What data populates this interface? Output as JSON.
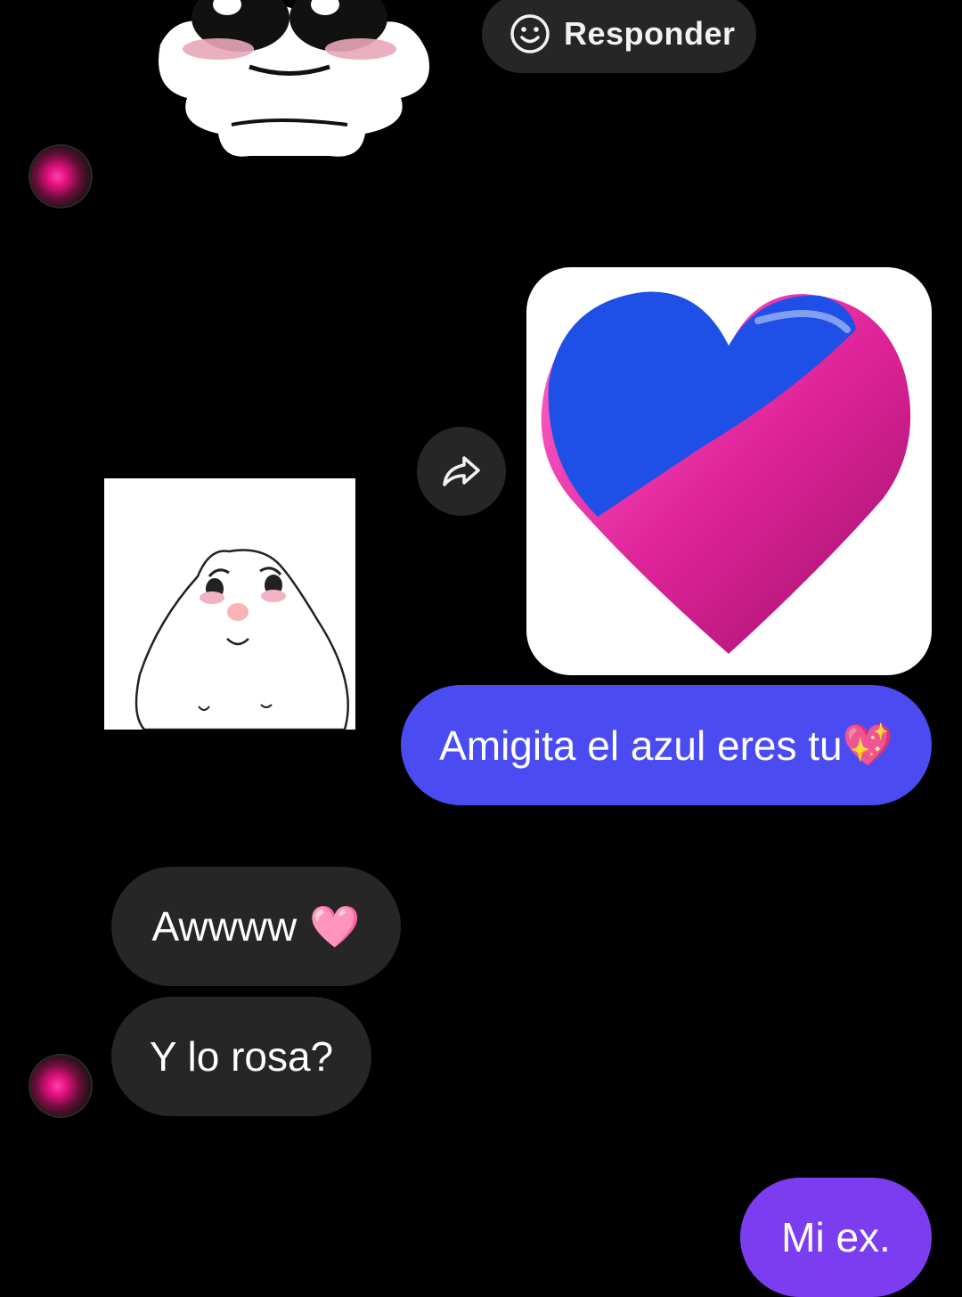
{
  "reply_action": {
    "label": "Responder",
    "icon": "smile-icon"
  },
  "forward_action": {
    "icon": "forward-arrow-icon"
  },
  "messages": [
    {
      "side": "outgoing",
      "text": "Amigita el azul eres tu",
      "emoji": "💖",
      "color": "#4a4cf2"
    },
    {
      "side": "incoming",
      "text": "Awwww",
      "emoji": "🩷",
      "color": "#262626"
    },
    {
      "side": "incoming",
      "text": "Y lo rosa?",
      "color": "#262626"
    },
    {
      "side": "outgoing",
      "text": "Mi ex.",
      "color": "#7c3df0"
    }
  ],
  "colors": {
    "background": "#000000",
    "incoming_bubble": "#262626",
    "outgoing_blue": "#4a4cf2",
    "outgoing_purple": "#7c3df0",
    "heart_blue": "#1e4fe6",
    "heart_pink": "#e0249a"
  }
}
